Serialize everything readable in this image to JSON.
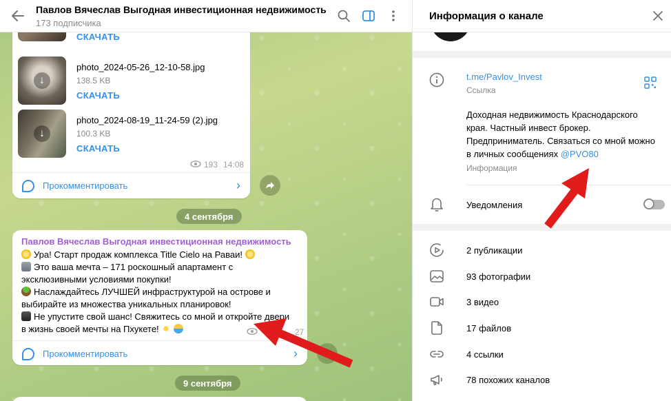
{
  "chat": {
    "title": "Павлов Вячеслав Выгодная инвестиционная недвижимость",
    "subscribers": "173 подписчика",
    "files": [
      {
        "name": "",
        "size": "",
        "download": "СКАЧАТЬ"
      },
      {
        "name": "photo_2024-05-26_12-10-58.jpg",
        "size": "138.5 KB",
        "download": "СКАЧАТЬ"
      },
      {
        "name": "photo_2024-08-19_11-24-59 (2).jpg",
        "size": "100.3 KB",
        "download": "СКАЧАТЬ"
      }
    ],
    "post1_views": "193",
    "post1_time": "14:08",
    "comment_label": "Прокомментировать",
    "date1": "4 сентября",
    "post2": {
      "author": "Павлов Вячеслав Выгодная инвестиционная недвижимость",
      "lines": [
        "Ура! Старт продаж комплекса Title Cielo на Раваи!",
        "Это ваша мечта – 171 роскошный апартамент с",
        "эксклюзивными условиями покупки!",
        "Наслаждайтесь ЛУЧШЕЙ инфраструктурой на острове и",
        "выбирайте из множества уникальных планировок!",
        "Не упустите свой шанс! Свяжитесь со мной и откройте двери",
        "в жизнь своей мечты на Пхукете!"
      ],
      "time_partial": "27",
      "comment_label": "Прокомментировать"
    },
    "date2": "9 сентября"
  },
  "info": {
    "title": "Информация о канале",
    "link": "t.me/Pavlov_Invest",
    "link_label": "Ссылка",
    "description": "Доходная недвижимость Краснодарского края. Частный инвест брокер. Предприниматель. Связаться со мной можно в личных сообщениях",
    "mention": "@PVO80",
    "description_label": "Информация",
    "notifications": "Уведомления",
    "media": [
      {
        "icon": "publications-icon",
        "label": "2 публикации"
      },
      {
        "icon": "photo-icon",
        "label": "93 фотографии"
      },
      {
        "icon": "video-icon",
        "label": "3 видео"
      },
      {
        "icon": "file-icon",
        "label": "17 файлов"
      },
      {
        "icon": "link-icon",
        "label": "4 ссылки"
      },
      {
        "icon": "megaphone-icon",
        "label": "78 похожих каналов"
      }
    ]
  },
  "colors": {
    "accent": "#3390ec",
    "author": "#a05fd4",
    "annotation_arrow": "#e01b1b"
  }
}
